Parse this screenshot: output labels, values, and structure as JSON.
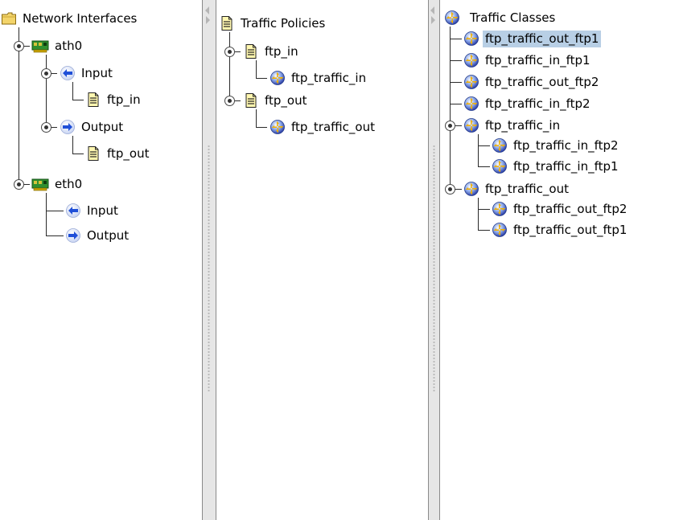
{
  "panes": {
    "interfaces": {
      "root": "Network Interfaces",
      "ath0": {
        "name": "ath0",
        "input": "Input",
        "input_policy": "ftp_in",
        "output": "Output",
        "output_policy": "ftp_out"
      },
      "eth0": {
        "name": "eth0",
        "input": "Input",
        "output": "Output"
      }
    },
    "policies": {
      "root": "Traffic Policies",
      "ftp_in": {
        "name": "ftp_in",
        "class": "ftp_traffic_in"
      },
      "ftp_out": {
        "name": "ftp_out",
        "class": "ftp_traffic_out"
      }
    },
    "classes": {
      "root": "Traffic Classes",
      "items": [
        "ftp_traffic_out_ftp1",
        "ftp_traffic_in_ftp1",
        "ftp_traffic_out_ftp2",
        "ftp_traffic_in_ftp2"
      ],
      "ftp_traffic_in": {
        "name": "ftp_traffic_in",
        "children": [
          "ftp_traffic_in_ftp2",
          "ftp_traffic_in_ftp1"
        ]
      },
      "ftp_traffic_out": {
        "name": "ftp_traffic_out",
        "children": [
          "ftp_traffic_out_ftp2",
          "ftp_traffic_out_ftp1"
        ]
      },
      "selected": "ftp_traffic_out_ftp1"
    }
  },
  "icons": {
    "folder": "folder-icon",
    "nic": "network-card-icon",
    "input": "input-arrow-icon",
    "output": "output-arrow-icon",
    "policy": "policy-document-icon",
    "class": "traffic-class-icon"
  },
  "colors": {
    "selection": "#b8cfe5",
    "arrow_blue": "#1f4fd8",
    "nic_green": "#2f8f2f"
  }
}
